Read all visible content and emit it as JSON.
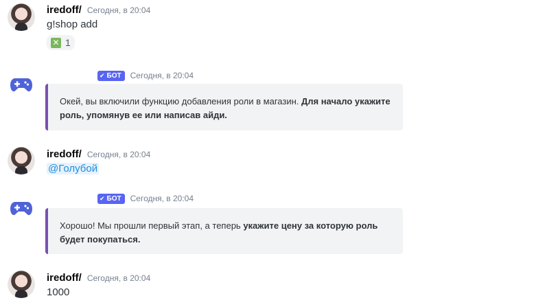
{
  "messages": [
    {
      "author": "iredoff/",
      "time": "Сегодня, в 20:04",
      "text": "g!shop add",
      "reaction": {
        "emoji": "x-mark",
        "count": "1"
      }
    },
    {
      "is_bot": true,
      "bot_tag": "БОТ",
      "time": "Сегодня, в 20:04",
      "embed": {
        "text": "Окей, вы включили функцию добавления роли в магазин. ",
        "bold": "Для начало укажите роль, упомянув ее или написав айди."
      }
    },
    {
      "author": "iredoff/",
      "time": "Сегодня, в 20:04",
      "mention": "@Голубой"
    },
    {
      "is_bot": true,
      "bot_tag": "БОТ",
      "time": "Сегодня, в 20:04",
      "embed": {
        "text": "Хорошо! Мы прошли первый этап, а теперь ",
        "bold": "укажите цену за которую роль будет покупаться."
      }
    },
    {
      "author": "iredoff/",
      "time": "Сегодня, в 20:04",
      "text": "1000"
    }
  ],
  "colors": {
    "bot_tag": "#5865f2",
    "embed_border": "#7b4fb0",
    "embed_bg": "#f2f3f5",
    "mention": "#1e8fd9",
    "reaction_emoji": "#7ab75b"
  }
}
